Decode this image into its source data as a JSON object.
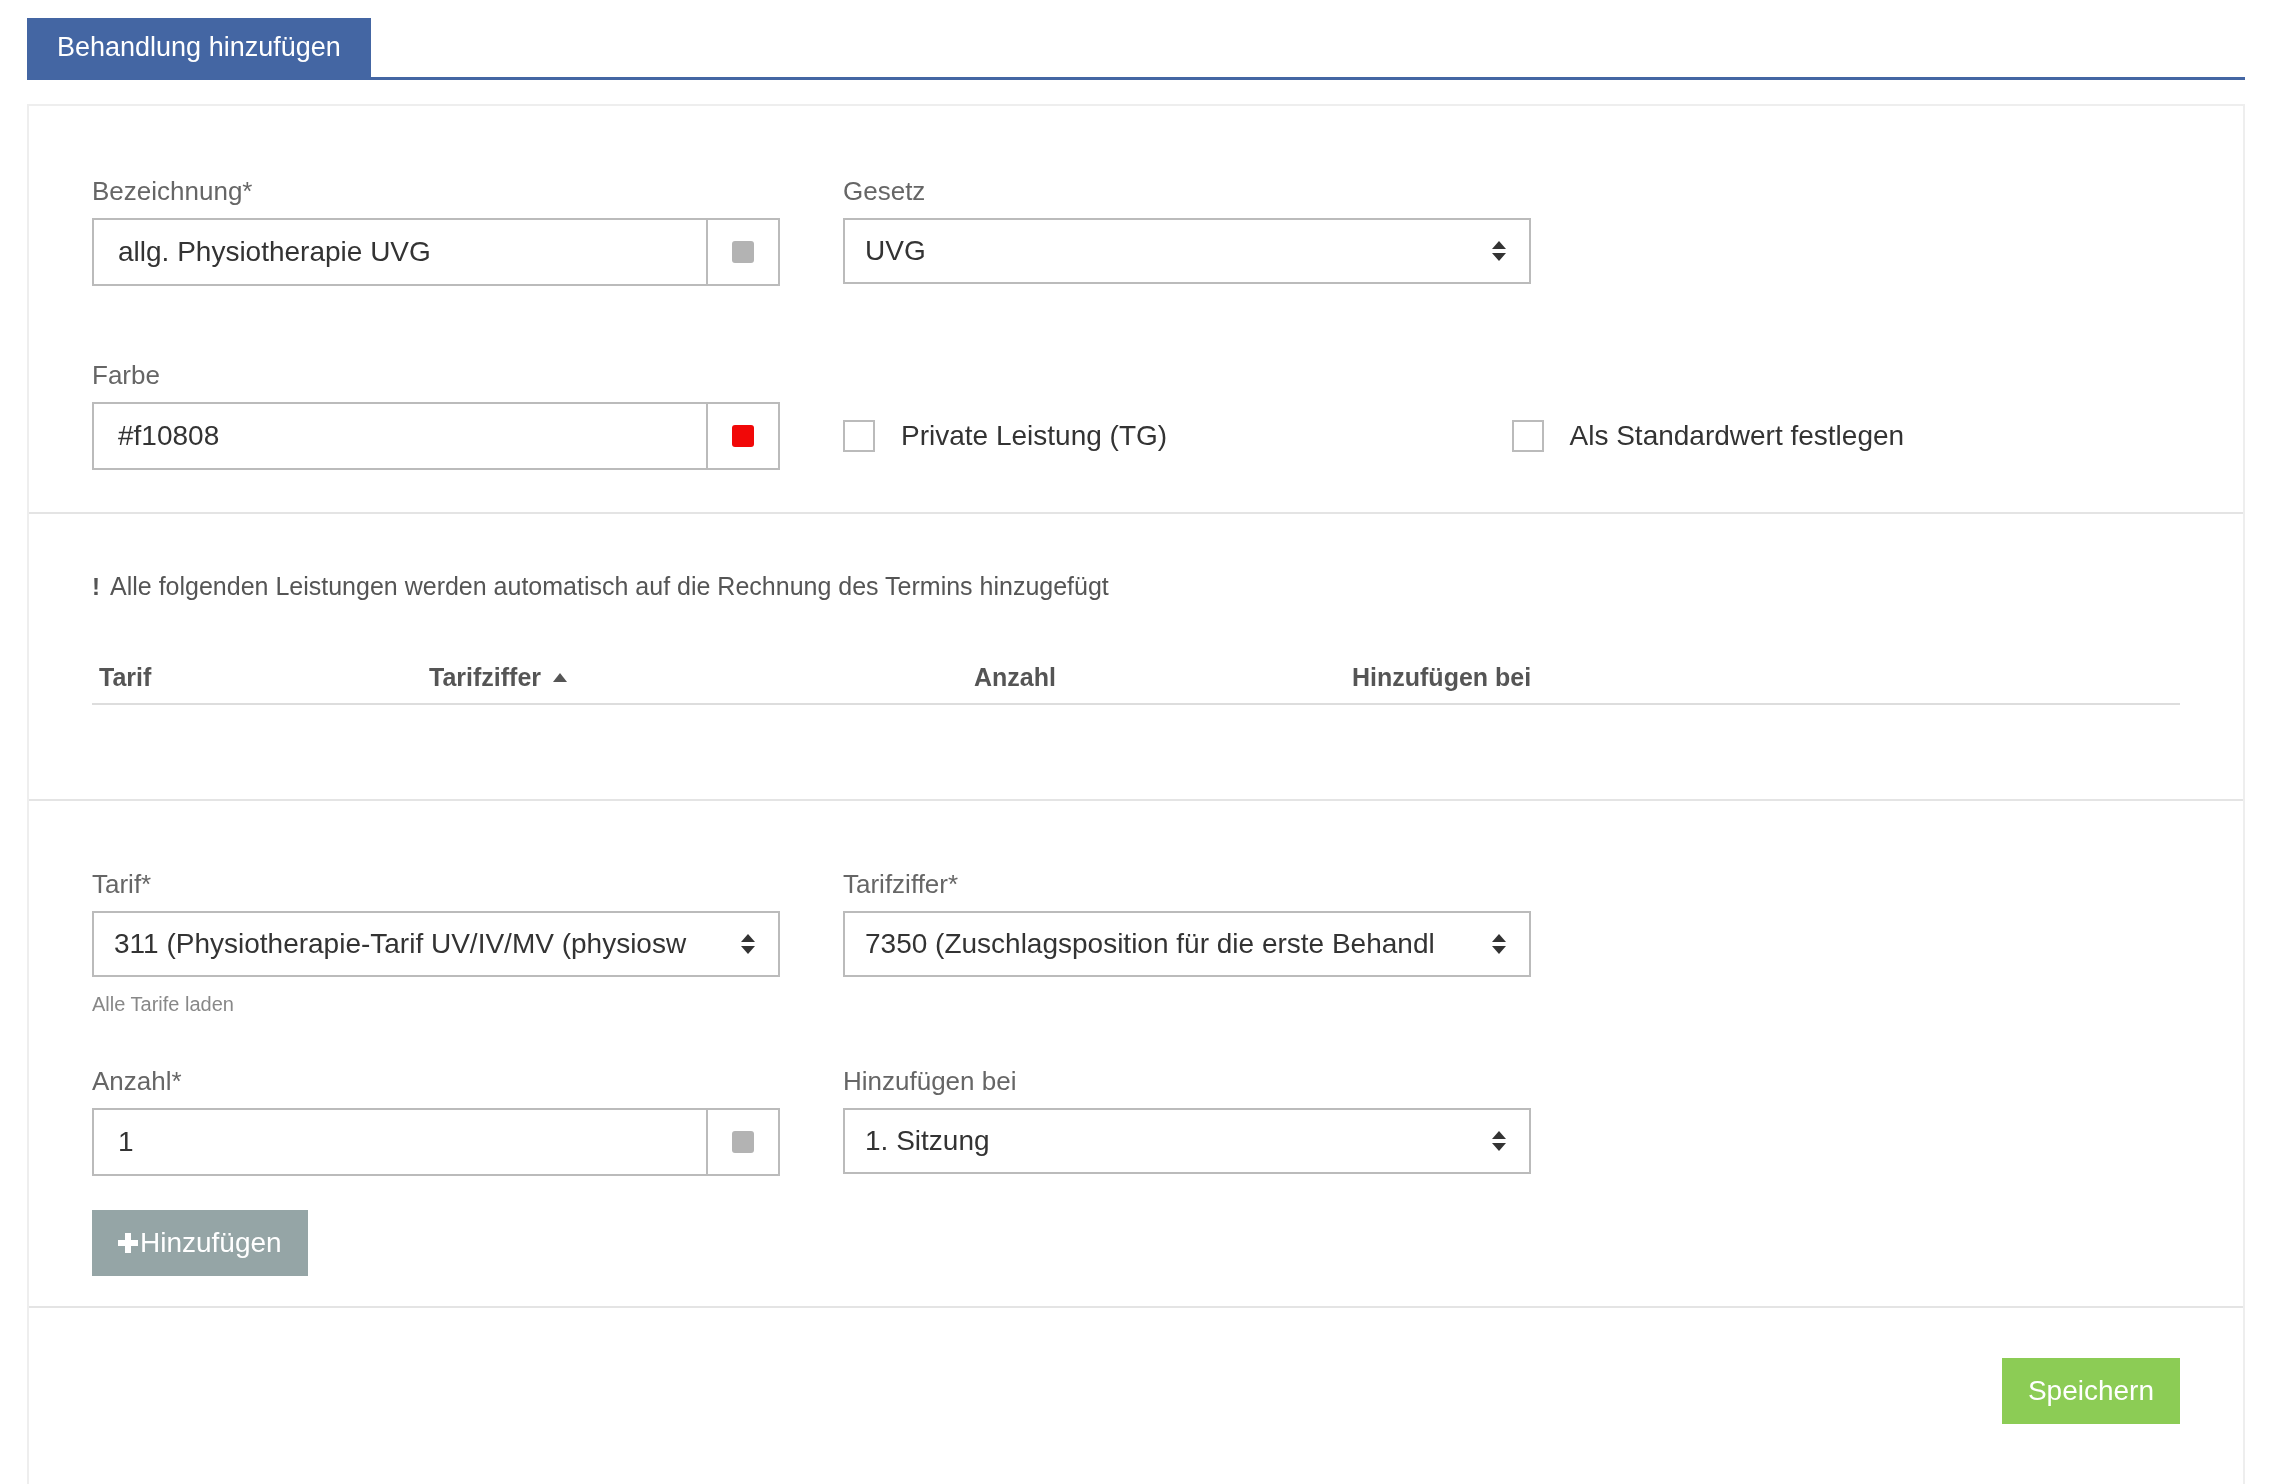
{
  "tab": {
    "label": "Behandlung hinzufügen",
    "selected": true
  },
  "general": {
    "rows": [
      [
        {
          "kind": "input",
          "label": "Bezeichnung*",
          "value": "allg. Physiotherapie UVG",
          "color": "#b3b3b3"
        },
        {
          "kind": "select",
          "label": "Gesetz",
          "value": "UVG"
        }
      ],
      [
        {
          "kind": "input",
          "label": "Farbe",
          "value": "#f10808",
          "color": "#f10808"
        },
        {
          "kind": "checkboxes",
          "items": [
            {
              "label": "Private Leistung (TG)",
              "checked": false
            },
            {
              "label": "Als Standardwert festlegen",
              "checked": false
            }
          ]
        }
      ]
    ]
  },
  "services": {
    "note_mark": "!",
    "note": "Alle folgenden Leistungen werden automatisch auf die Rechnung des Termins hinzugefügt",
    "columns": [
      {
        "label": "Tarif",
        "sorted": false
      },
      {
        "label": "Tarifziffer",
        "sorted": true
      },
      {
        "label": "Anzahl",
        "sorted": false
      },
      {
        "label": "Hinzufügen bei",
        "sorted": false
      }
    ]
  },
  "new_service": {
    "rows": [
      [
        {
          "kind": "select",
          "label": "Tarif*",
          "value": "311 (Physiotherapie-Tarif UV/IV/MV (physiosw",
          "link": "Alle Tarife laden"
        },
        {
          "kind": "select",
          "label": "Tarifziffer*",
          "value": "7350 (Zuschlagsposition für die erste Behandl"
        }
      ],
      [
        {
          "kind": "input",
          "label": "Anzahl*",
          "value": "1",
          "color": "#b3b3b3"
        },
        {
          "kind": "select",
          "label": "Hinzufügen bei",
          "value": "1. Sitzung"
        }
      ]
    ],
    "add_button": "Hinzufügen"
  },
  "save_button": "Speichern"
}
